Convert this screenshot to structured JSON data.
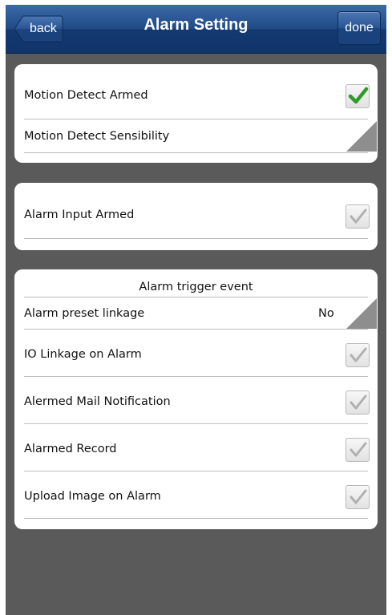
{
  "header": {
    "title": "Alarm Setting",
    "back_label": "back",
    "done_label": "done"
  },
  "motion_section": {
    "armed_label": "Motion Detect Armed",
    "armed_checked": true,
    "sensibility_label": "Motion Detect Sensibility"
  },
  "input_section": {
    "armed_label": "Alarm Input Armed",
    "armed_checked": false
  },
  "trigger_section": {
    "title": "Alarm trigger event",
    "preset_label": "Alarm preset linkage",
    "preset_value": "No",
    "io_linkage_label": "IO Linkage on Alarm",
    "mail_label": "Alermed Mail Notification",
    "record_label": "Alarmed Record",
    "upload_label": "Upload Image on Alarm"
  },
  "colors": {
    "header_blue": "#1f4a86",
    "check_green": "#2e9a2a",
    "check_gray": "#b0b0b0",
    "background": "#5a5a5a"
  }
}
